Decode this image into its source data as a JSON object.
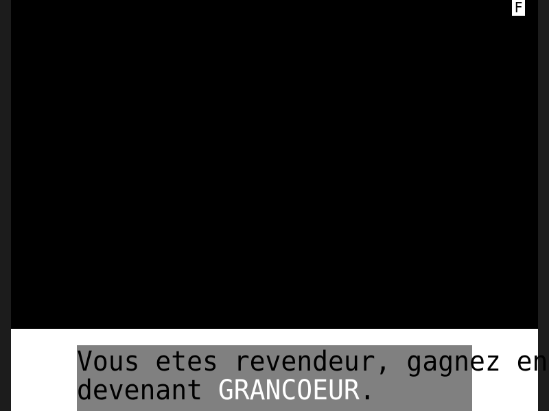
{
  "indicator": {
    "label": "F"
  },
  "message": {
    "line1": "Vous etes revendeur, gagnez en",
    "line2_before": "devenant ",
    "line2_highlight": "GRANCOEUR",
    "line2_after": "."
  },
  "colors": {
    "display": "#000000",
    "panel": "#ffffff",
    "message_bg": "#808080",
    "text": "#000000",
    "highlight": "#ffffff",
    "frame": "#1c1c1c"
  }
}
